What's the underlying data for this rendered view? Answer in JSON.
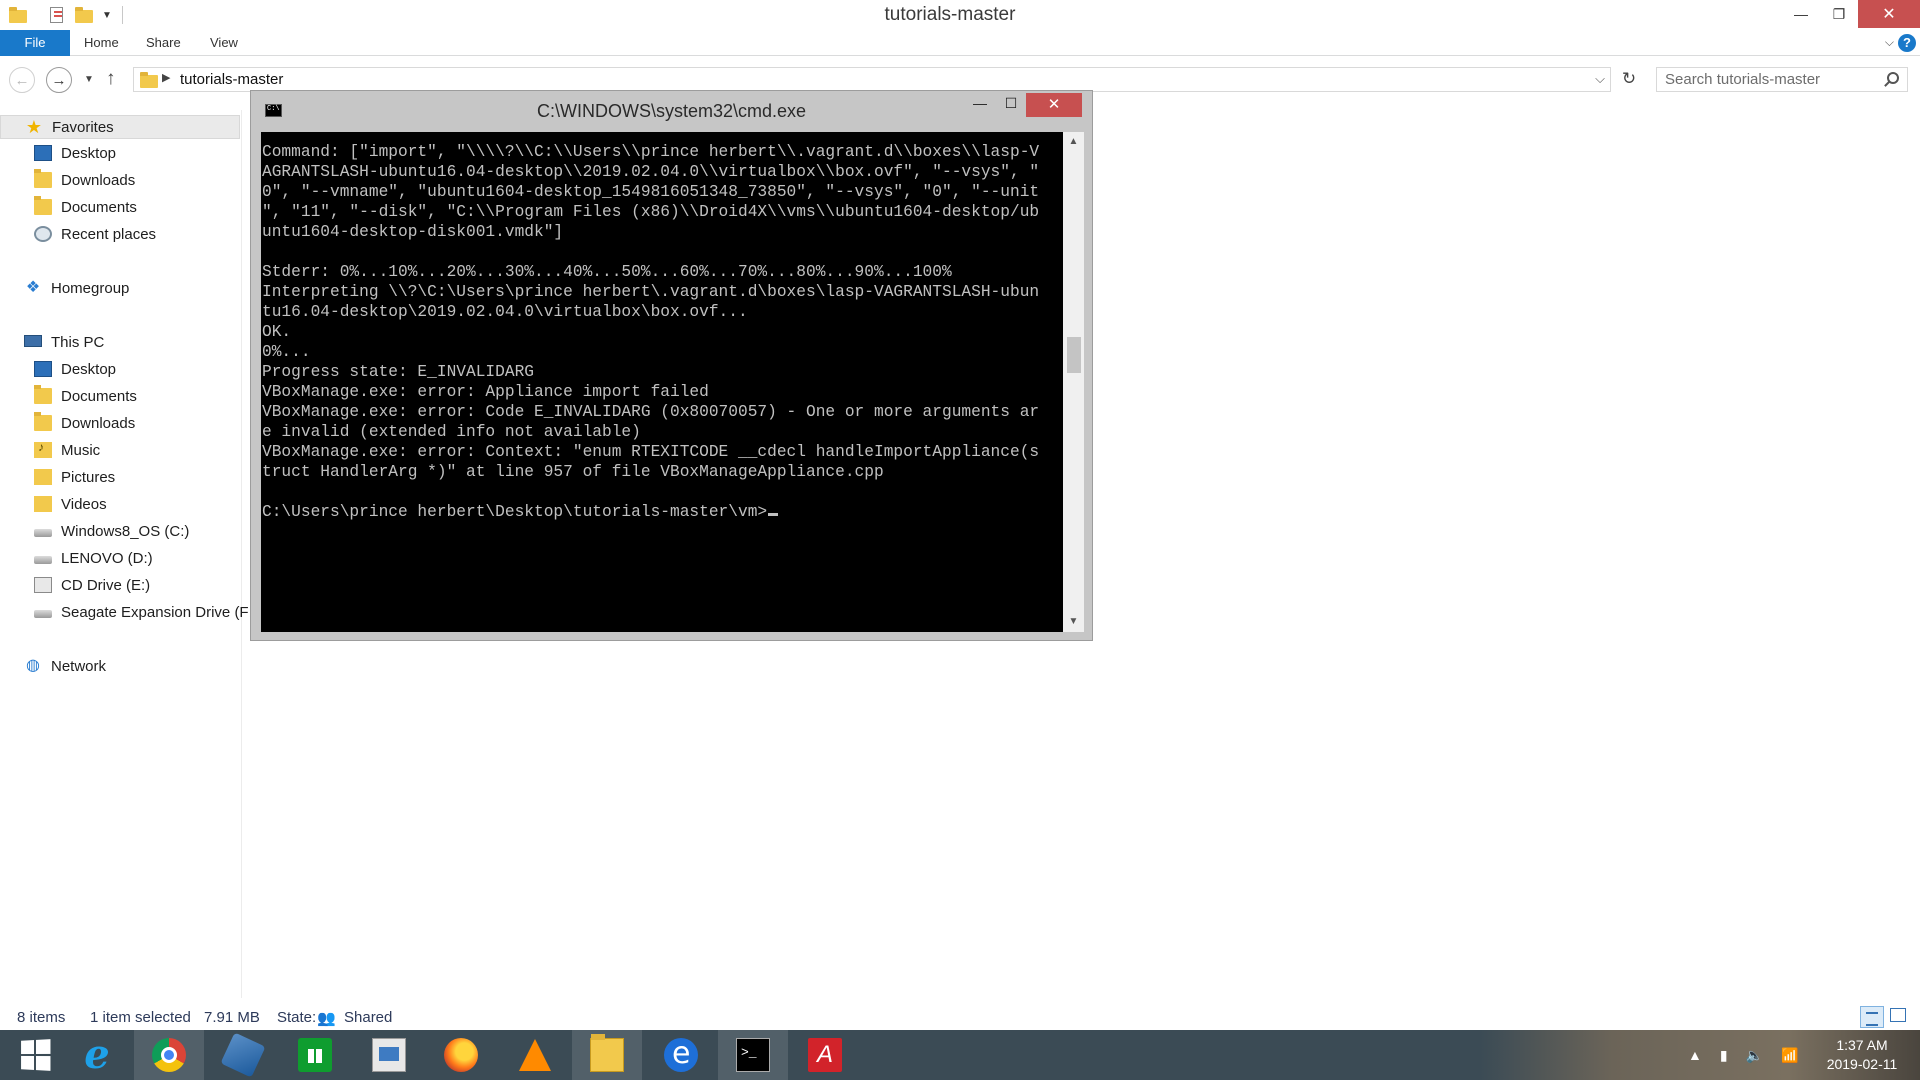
{
  "explorer": {
    "title": "tutorials-master",
    "ribbon": {
      "file": "File",
      "home": "Home",
      "share": "Share",
      "view": "View",
      "help": "?"
    },
    "address": {
      "path": "tutorials-master"
    },
    "search": {
      "placeholder": "Search tutorials-master"
    },
    "nav": {
      "favorites": "Favorites",
      "fav_desktop": "Desktop",
      "fav_downloads": "Downloads",
      "fav_documents": "Documents",
      "fav_recent": "Recent places",
      "homegroup": "Homegroup",
      "this_pc": "This PC",
      "pc_desktop": "Desktop",
      "pc_documents": "Documents",
      "pc_downloads": "Downloads",
      "pc_music": "Music",
      "pc_pictures": "Pictures",
      "pc_videos": "Videos",
      "drive_c": "Windows8_OS (C:)",
      "drive_d": "LENOVO (D:)",
      "drive_e": "CD Drive (E:)",
      "drive_f": "Seagate Expansion Drive (F:",
      "network": "Network"
    },
    "status": {
      "items": "8 items",
      "selected": "1 item selected",
      "size": "7.91 MB",
      "state_label": "State:",
      "state_value": "Shared"
    }
  },
  "cmd": {
    "title": "C:\\WINDOWS\\system32\\cmd.exe",
    "lines": [
      "Command: [\"import\", \"\\\\\\\\?\\\\C:\\\\Users\\\\prince herbert\\\\.vagrant.d\\\\boxes\\\\lasp-V",
      "AGRANTSLASH-ubuntu16.04-desktop\\\\2019.02.04.0\\\\virtualbox\\\\box.ovf\", \"--vsys\", \"",
      "0\", \"--vmname\", \"ubuntu1604-desktop_1549816051348_73850\", \"--vsys\", \"0\", \"--unit",
      "\", \"11\", \"--disk\", \"C:\\\\Program Files (x86)\\\\Droid4X\\\\vms\\\\ubuntu1604-desktop/ub",
      "untu1604-desktop-disk001.vmdk\"]",
      "",
      "Stderr: 0%...10%...20%...30%...40%...50%...60%...70%...80%...90%...100%",
      "Interpreting \\\\?\\C:\\Users\\prince herbert\\.vagrant.d\\boxes\\lasp-VAGRANTSLASH-ubun",
      "tu16.04-desktop\\2019.02.04.0\\virtualbox\\box.ovf...",
      "OK.",
      "0%...",
      "Progress state: E_INVALIDARG",
      "VBoxManage.exe: error: Appliance import failed",
      "VBoxManage.exe: error: Code E_INVALIDARG (0x80070057) - One or more arguments ar",
      "e invalid (extended info not available)",
      "VBoxManage.exe: error: Context: \"enum RTEXITCODE __cdecl handleImportAppliance(s",
      "truct HandlerArg *)\" at line 957 of file VBoxManageAppliance.cpp",
      "",
      "C:\\Users\\prince herbert\\Desktop\\tutorials-master\\vm>"
    ]
  },
  "taskbar": {
    "clock_time": "1:37 AM",
    "clock_date": "2019-02-11",
    "apps": [
      "start",
      "internet-explorer",
      "chrome",
      "virtualbox",
      "store",
      "document",
      "firefox",
      "vlc",
      "file-explorer",
      "edge",
      "command-prompt",
      "acrobat"
    ]
  }
}
